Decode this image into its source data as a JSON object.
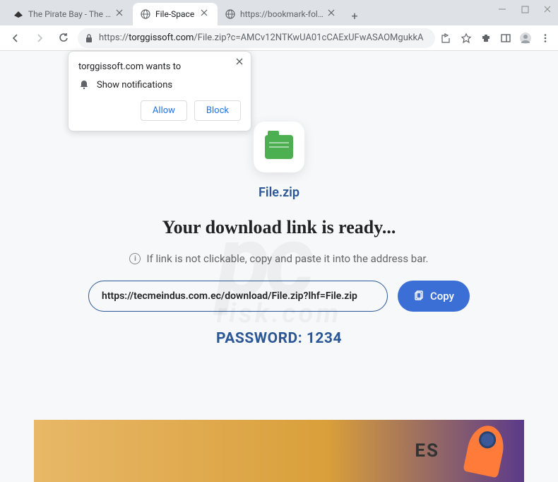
{
  "window": {
    "tabs": [
      {
        "title": "The Pirate Bay - The galaxy's",
        "favicon": "ship"
      },
      {
        "title": "File-Space",
        "favicon": "globe",
        "active": true
      },
      {
        "title": "https://bookmark-folders.com",
        "favicon": "globe"
      }
    ],
    "url": {
      "scheme": "https://",
      "host": "torggissoft.com",
      "path": "/File.zip?c=AMCv12NTKwUA01cCAExUFwASAOMgukkA"
    }
  },
  "notification": {
    "site_wants": "torggissoft.com wants to",
    "permission": "Show notifications",
    "allow": "Allow",
    "block": "Block"
  },
  "page": {
    "file_name": "File.zip",
    "headline": "Your download link is ready...",
    "hint": "If link is not clickable, copy and paste it into the address bar.",
    "download_url": "https://tecmeindus.com.ec/download/File.zip?lhf=File.zip",
    "copy_label": "Copy",
    "password_label": "PASSWORD: 1234",
    "ad_text": "ES"
  },
  "watermark": {
    "main": "pc",
    "sub": "risk.com"
  }
}
